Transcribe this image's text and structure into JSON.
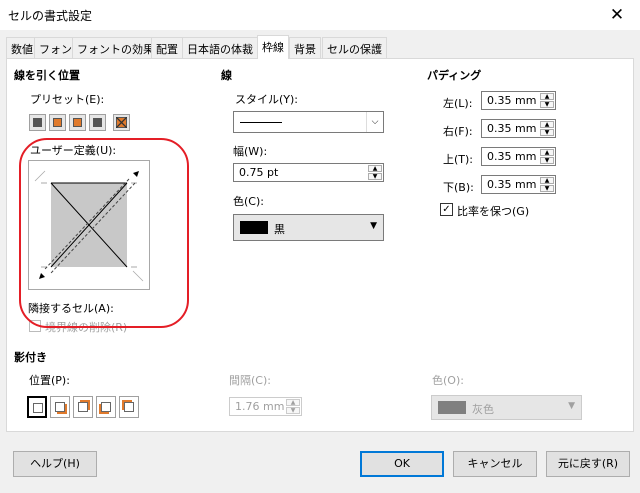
{
  "window": {
    "title": "セルの書式設定",
    "close_label": "✕"
  },
  "tabs": [
    "数値",
    "フォント",
    "フォントの効果",
    "配置",
    "日本語の体裁",
    "枠線",
    "背景",
    "セルの保護"
  ],
  "border_position": {
    "heading": "線を引く位置",
    "presets_label": "プリセット(E):",
    "user_defined_label": "ユーザー定義(U):",
    "adjacent_label": "隣接するセル(A):",
    "remove_border_label": "境界線の削除(R)"
  },
  "line": {
    "heading": "線",
    "style_label": "スタイル(Y):",
    "width_label": "幅(W):",
    "width_value": "0.75 pt",
    "color_label": "色(C):",
    "color_value": "黒",
    "color_swatch": "#000000"
  },
  "padding": {
    "heading": "パディング",
    "left_label": "左(L):",
    "left_value": "0.35 mm",
    "right_label": "右(F):",
    "right_value": "0.35 mm",
    "top_label": "上(T):",
    "top_value": "0.35 mm",
    "bottom_label": "下(B):",
    "bottom_value": "0.35 mm",
    "sync_label": "比率を保つ(G)",
    "sync_checked": true
  },
  "shadow": {
    "heading": "影付き",
    "position_label": "位置(P):",
    "distance_label": "間隔(C):",
    "distance_value": "1.76 mm",
    "color_label": "色(O):",
    "color_value": "灰色",
    "color_swatch": "#808080"
  },
  "buttons": {
    "help": "ヘルプ(H)",
    "ok": "OK",
    "cancel": "キャンセル",
    "reset": "元に戻す(R)"
  },
  "colors": {
    "accent": "#0078d7",
    "annotation": "#e41e26",
    "preset_fill": "#e07a2c"
  }
}
